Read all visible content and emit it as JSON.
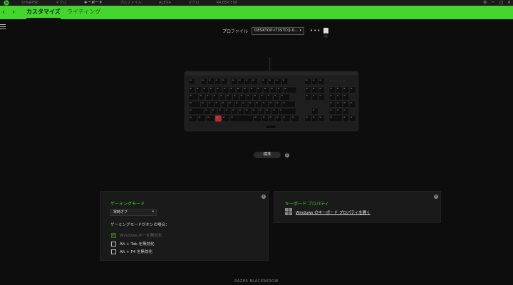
{
  "topnav": {
    "items": [
      "SYNAPSE",
      "マクロ",
      "キーボード",
      "プロファイル",
      "ALEXA",
      "マクロ",
      "RAZER ESP"
    ],
    "active_index": 2
  },
  "window_controls": {
    "settings": "⚙",
    "minimize": "─",
    "maximize": "□",
    "close": "✕"
  },
  "subnav": {
    "back": "‹",
    "forward": "›",
    "tabs": [
      {
        "label": "カスタマイズ",
        "active": true
      },
      {
        "label": "ライティング",
        "active": false
      }
    ]
  },
  "profile": {
    "label": "プロファイル",
    "selected": "DESKTOP-I73STCQ-0...",
    "more": "•••"
  },
  "keyboard": {
    "brand": "RAZER",
    "highlight_color": "#c0282d"
  },
  "standard_button": "標準",
  "gaming_mode": {
    "title": "ゲーミングモード",
    "select_value": "常時オフ",
    "subheading": "ゲーミングモードがオンの場合：",
    "options": [
      {
        "label": "Windows キーを無効化",
        "checked": true,
        "disabled": true
      },
      {
        "label": "Alt + Tab を無効化",
        "checked": false,
        "disabled": false
      },
      {
        "label": "Alt + F4 を無効化",
        "checked": false,
        "disabled": false
      }
    ]
  },
  "keyboard_props": {
    "title": "キーボード プロパティ",
    "link": "Windows のキーボード プロパティを開く"
  },
  "footer": "RAZER BLACKWIDOW",
  "colors": {
    "accent": "#44d62c",
    "background": "#0d0d0d",
    "panel": "#1a1a1a"
  }
}
